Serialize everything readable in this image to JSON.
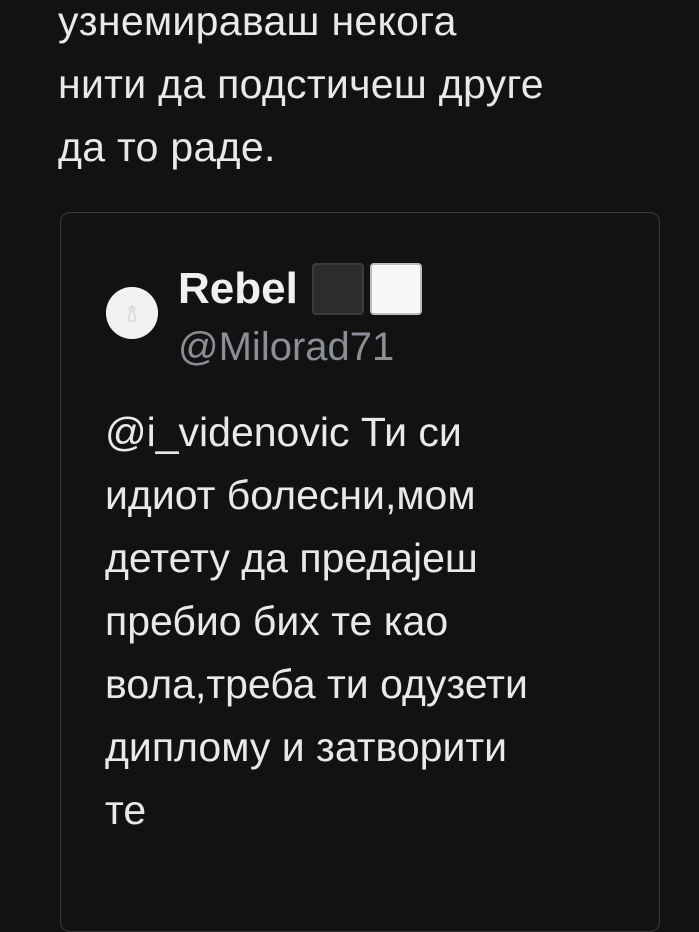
{
  "tweet": {
    "text_lines": [
      "узнемираваш некога",
      "нити да подстичеш друге",
      "да то раде."
    ]
  },
  "quoted_tweet": {
    "display_name": "Rebel",
    "name_emojis": [
      "black-large-square",
      "white-large-square"
    ],
    "handle": "@Milorad71",
    "body_lines": [
      "@i_videnovic Ти си",
      "идиот болесни,мом",
      "детету да предајеш",
      "пребио бих те као",
      "вола,треба ти одузети",
      "диплому и затворити",
      "те"
    ]
  },
  "colors": {
    "background": "#121212",
    "text": "#e9e9e9",
    "handle": "#8a8f96",
    "card_border": "#3a3a3a"
  }
}
